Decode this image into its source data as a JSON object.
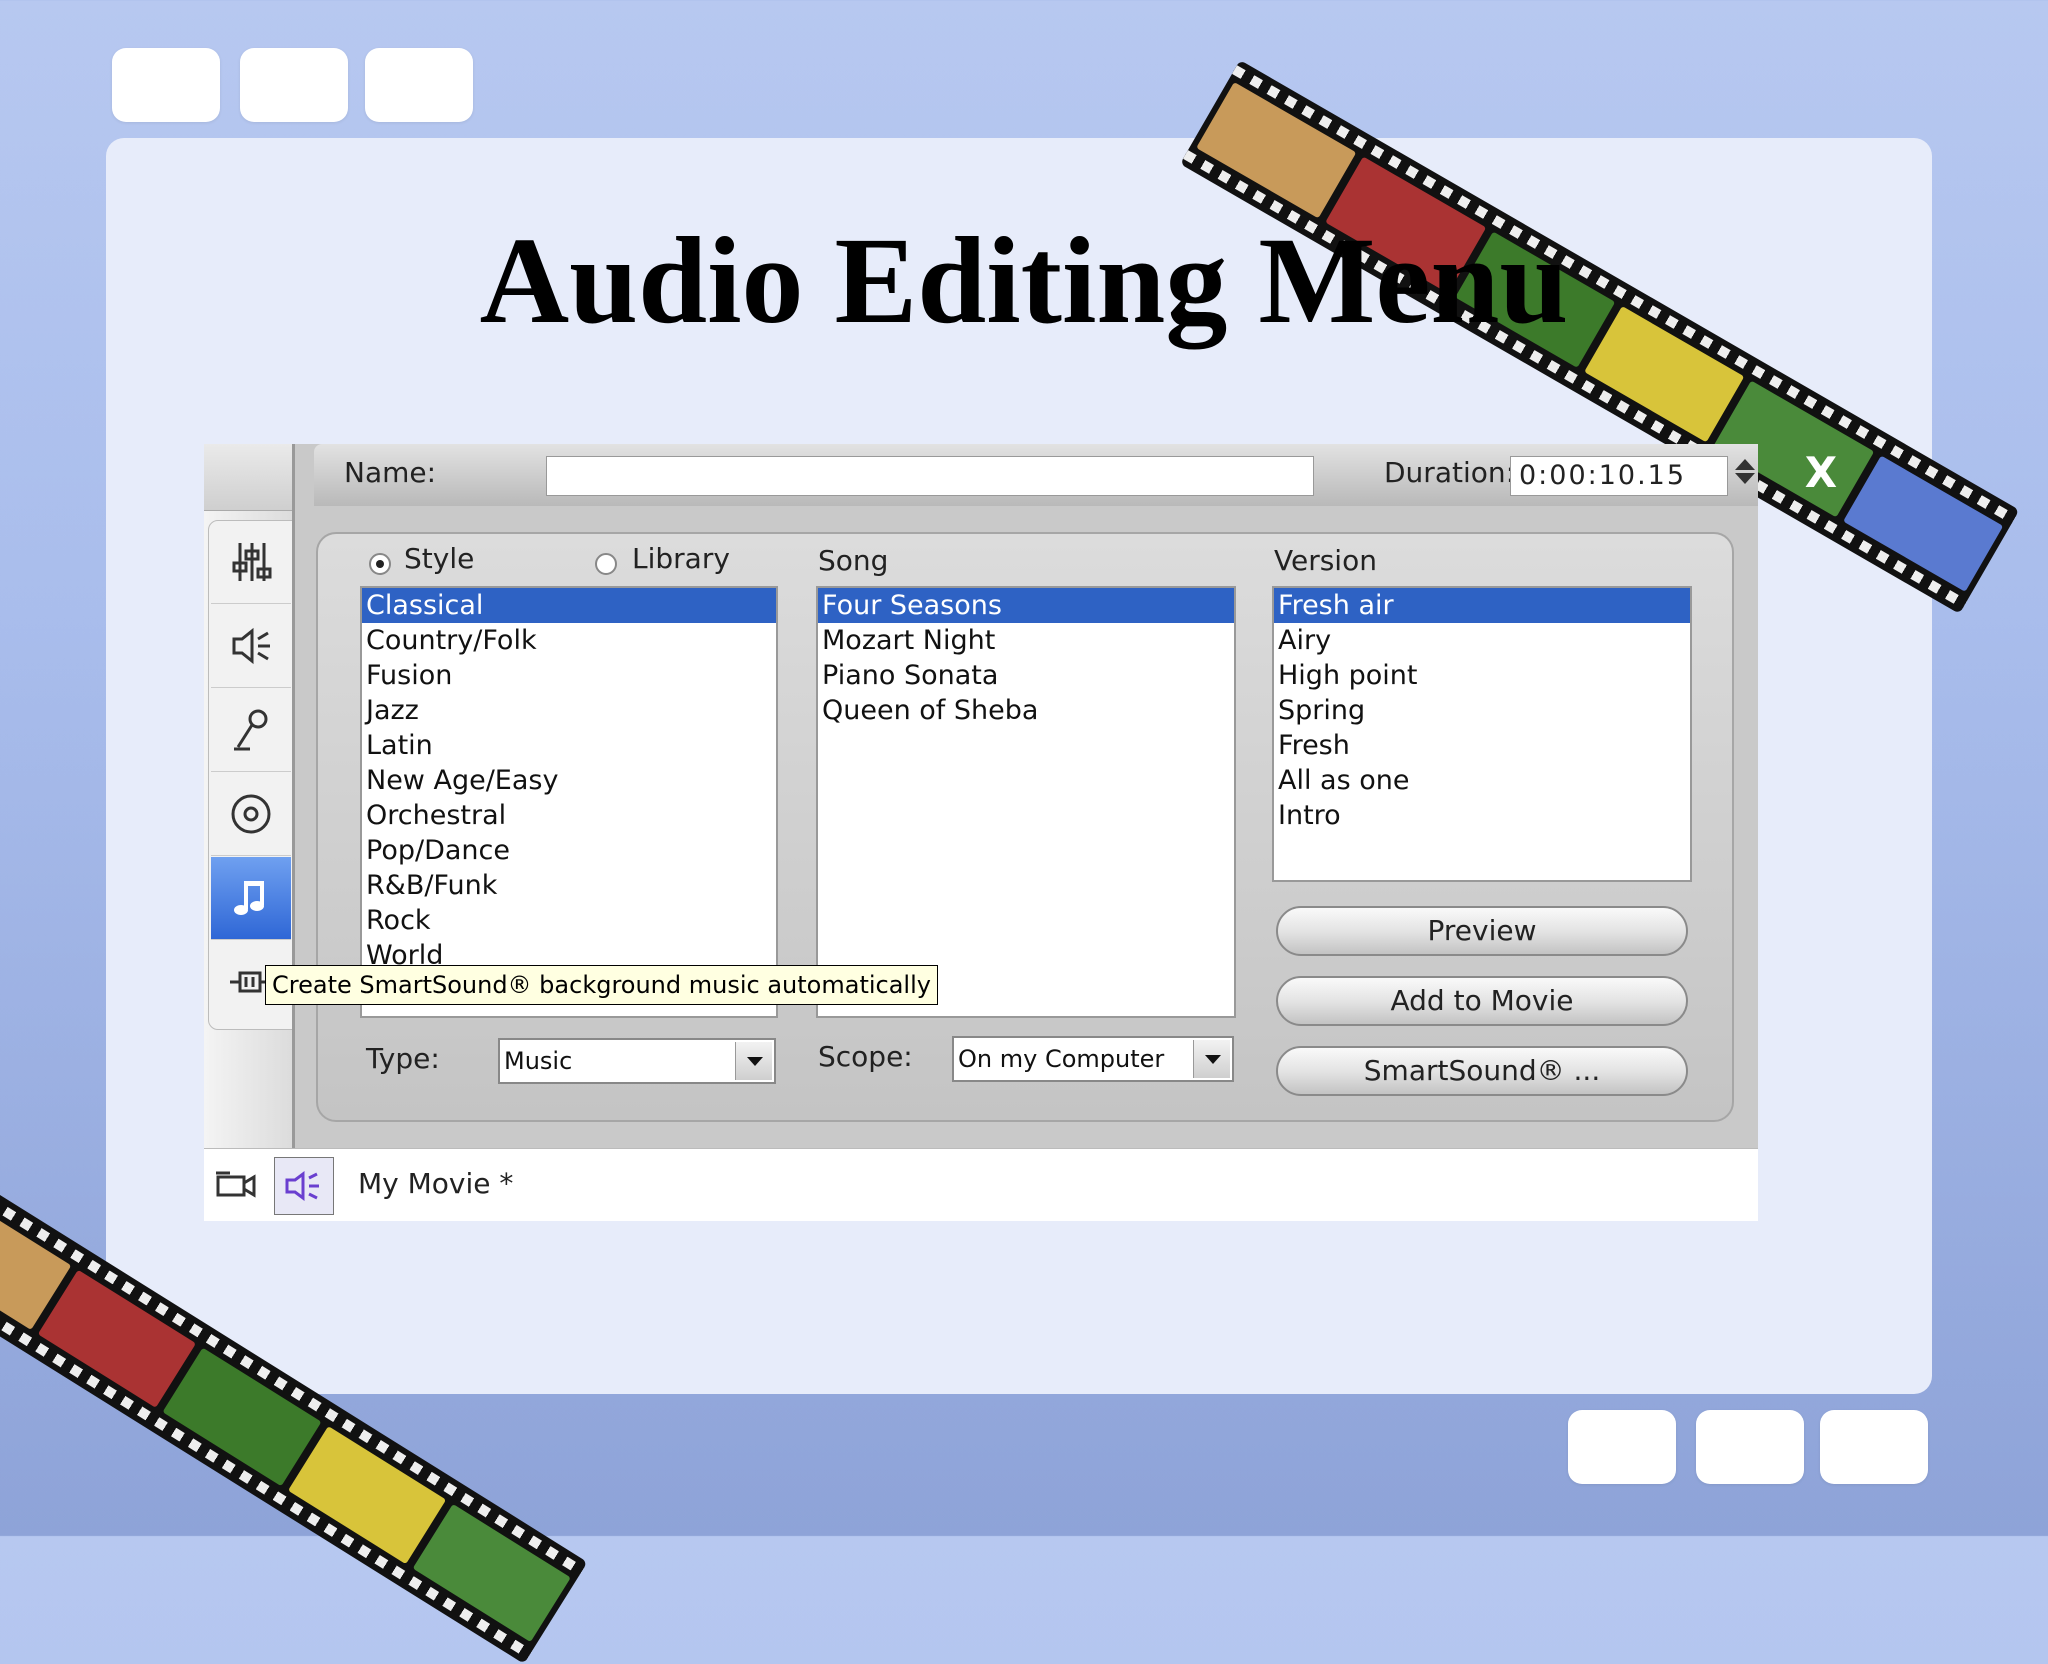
{
  "slide": {
    "title": "Audio Editing Menu"
  },
  "header": {
    "name_label": "Name:",
    "name_value": "",
    "duration_label": "Duration:",
    "duration_value": "0:00:10.15",
    "close_label": "X"
  },
  "sidebar": {
    "icons": [
      "audio-mixer-icon",
      "speaker-icon",
      "microphone-icon",
      "cd-disc-icon",
      "music-note-icon",
      "video-plug-icon"
    ],
    "active_icon": "music-note-icon"
  },
  "source": {
    "style_label": "Style",
    "library_label": "Library",
    "selected": "Style"
  },
  "style_list": {
    "items": [
      "Classical",
      "Country/Folk",
      "Fusion",
      "Jazz",
      "Latin",
      "New Age/Easy",
      "Orchestral",
      "Pop/Dance",
      "R&B/Funk",
      "Rock",
      "World"
    ],
    "selected": "Classical"
  },
  "song": {
    "label": "Song",
    "items": [
      "Four Seasons",
      "Mozart Night",
      "Piano Sonata",
      "Queen of Sheba"
    ],
    "selected": "Four Seasons"
  },
  "version": {
    "label": "Version",
    "items": [
      "Fresh air",
      "Airy",
      "High point",
      "Spring",
      "Fresh",
      "All as one",
      "Intro"
    ],
    "selected": "Fresh air"
  },
  "buttons": {
    "preview": "Preview",
    "add_to_movie": "Add to Movie",
    "smartsound": "SmartSound® ..."
  },
  "type": {
    "label": "Type:",
    "value": "Music"
  },
  "scope": {
    "label": "Scope:",
    "value": "On my Computer"
  },
  "tooltip": {
    "text": "Create SmartSound® background music automatically"
  },
  "status": {
    "movie_title": "My Movie *"
  },
  "colors": {
    "selection": "#2e62c4",
    "background": "#a9bdec",
    "panel": "#e7ecfa",
    "active_tool": "#3a74dc"
  }
}
